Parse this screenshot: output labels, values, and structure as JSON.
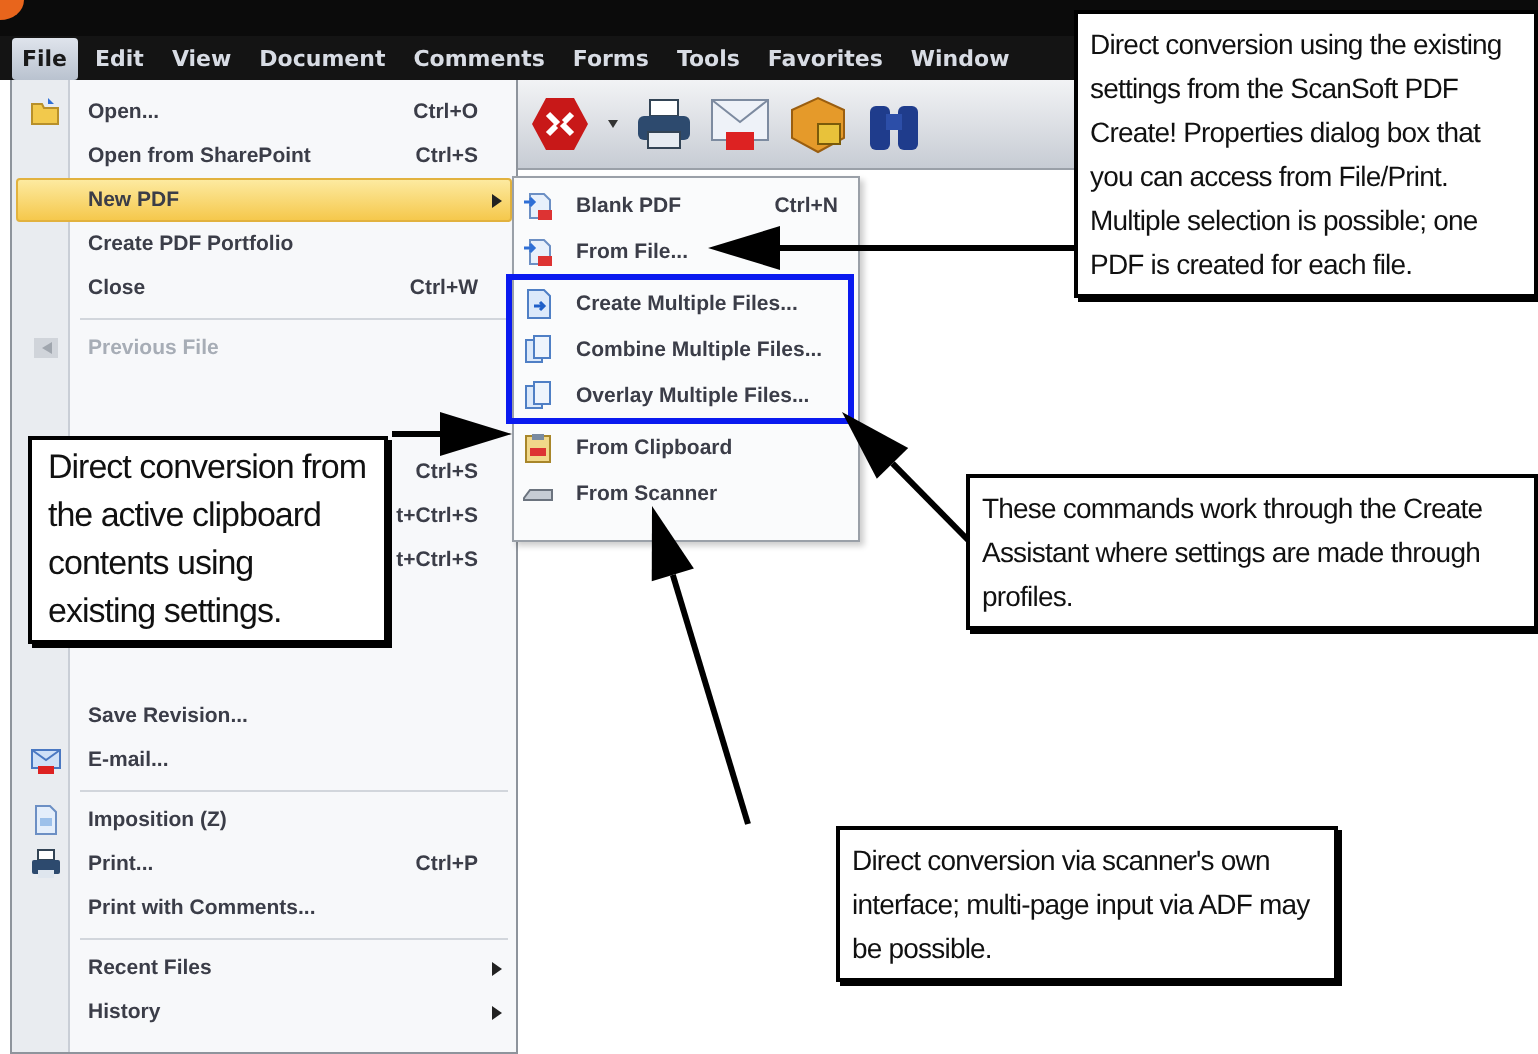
{
  "menubar": [
    {
      "label": "File",
      "selected": true
    },
    {
      "label": "Edit",
      "selected": false
    },
    {
      "label": "View",
      "selected": false
    },
    {
      "label": "Document",
      "selected": false
    },
    {
      "label": "Comments",
      "selected": false
    },
    {
      "label": "Forms",
      "selected": false
    },
    {
      "label": "Tools",
      "selected": false
    },
    {
      "label": "Favorites",
      "selected": false
    },
    {
      "label": "Window",
      "selected": false
    }
  ],
  "file_menu": [
    {
      "kind": "command",
      "label": "Open...",
      "shortcut": "Ctrl+O",
      "submenu": false,
      "selected": false,
      "disabled": false
    },
    {
      "kind": "command",
      "label": "Open from SharePoint",
      "shortcut": "Ctrl+S",
      "submenu": false,
      "selected": false,
      "disabled": false
    },
    {
      "kind": "command",
      "label": "New PDF",
      "submenu": true,
      "selected": true,
      "disabled": false
    },
    {
      "kind": "command",
      "label": "Create PDF Portfolio",
      "submenu": false,
      "selected": false,
      "disabled": false
    },
    {
      "kind": "command",
      "label": "Close",
      "shortcut": "Ctrl+W",
      "submenu": false,
      "selected": false,
      "disabled": false
    },
    {
      "kind": "separator"
    },
    {
      "kind": "command",
      "label": "Previous File",
      "submenu": false,
      "selected": false,
      "disabled": true
    },
    {
      "kind": "covered",
      "shortcut": "Ctrl+S"
    },
    {
      "kind": "covered",
      "shortcut": "t+Ctrl+S"
    },
    {
      "kind": "covered",
      "shortcut": "t+Ctrl+S"
    },
    {
      "kind": "command",
      "label": "Save Revision...",
      "submenu": false,
      "selected": false,
      "disabled": false
    },
    {
      "kind": "command",
      "label": "E-mail...",
      "submenu": false,
      "selected": false,
      "disabled": false
    },
    {
      "kind": "separator"
    },
    {
      "kind": "command",
      "label": "Imposition (Z)",
      "submenu": false,
      "selected": false,
      "disabled": false
    },
    {
      "kind": "command",
      "label": "Print...",
      "shortcut": "Ctrl+P",
      "submenu": false,
      "selected": false,
      "disabled": false
    },
    {
      "kind": "command",
      "label": "Print with Comments...",
      "submenu": false,
      "selected": false,
      "disabled": false
    },
    {
      "kind": "separator"
    },
    {
      "kind": "command",
      "label": "Recent Files",
      "submenu": true,
      "selected": false,
      "disabled": false
    },
    {
      "kind": "command",
      "label": "History",
      "submenu": true,
      "selected": false,
      "disabled": false
    }
  ],
  "new_pdf_submenu": [
    {
      "label": "Blank PDF",
      "shortcut": "Ctrl+N",
      "outlined": false
    },
    {
      "label": "From File...",
      "outlined": false
    },
    {
      "label": "Create Multiple Files...",
      "outlined": true
    },
    {
      "label": "Combine Multiple Files...",
      "outlined": true
    },
    {
      "label": "Overlay Multiple Files...",
      "outlined": true
    },
    {
      "label": "From Clipboard",
      "outlined": false
    },
    {
      "label": "From Scanner",
      "outlined": false
    }
  ],
  "callouts": [
    {
      "text": "Direct conversion using the existing settings from the ScanSoft PDF Create! Properties dialog box that you can access from File/Print. Multiple selection is possible; one PDF is created for each file."
    },
    {
      "text": "Direct conversion from the active clipboard contents using existing settings."
    },
    {
      "text": "These commands work through the Create Assistant where settings are made through profiles."
    },
    {
      "text": "Direct conversion via scanner's own interface; multi-page input via ADF may be possible."
    }
  ]
}
